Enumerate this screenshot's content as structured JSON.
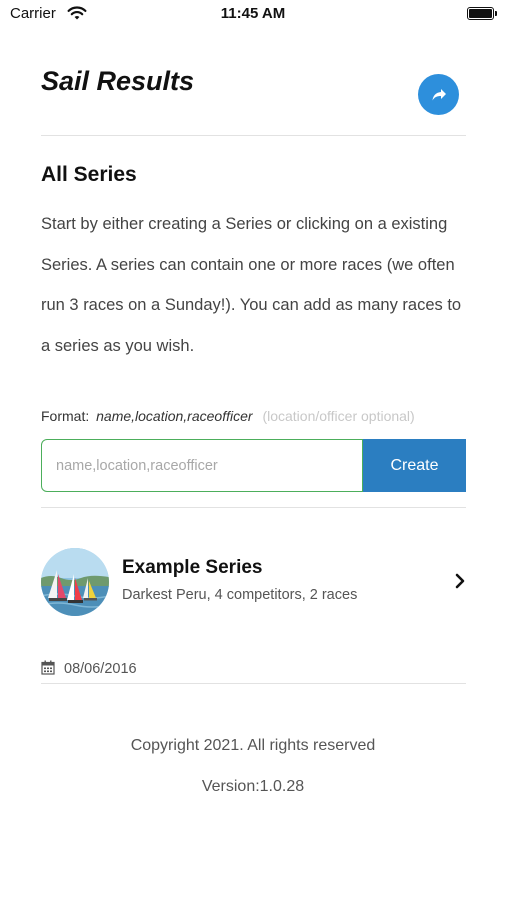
{
  "status_bar": {
    "carrier": "Carrier",
    "time": "11:45 AM",
    "battery_level": 1.0
  },
  "header": {
    "title": "Sail Results",
    "share_icon": "share-icon",
    "accent_color": "#2d8fdc"
  },
  "series_section": {
    "title": "All Series",
    "intro_text": "Start by either creating a Series or clicking on a existing Series. A series can contain one or more races (we often run 3 races on a Sunday!). You can add as many races to a series as you wish."
  },
  "create_form": {
    "format_label": "Format:",
    "format_example": "name,location,raceofficer",
    "format_optional": "(location/officer optional)",
    "input_value": "",
    "input_placeholder": "name,location,raceofficer",
    "create_label": "Create",
    "input_border_color": "#4cae5b",
    "button_color": "#2b7ec1"
  },
  "series_list": [
    {
      "name": "Example Series",
      "detail": "Darkest Peru, 4 competitors, 2 races",
      "date": "08/06/2016",
      "icon": "chevron-right-icon"
    }
  ],
  "footer": {
    "copyright": "Copyright 2021. All rights reserved",
    "version": "Version:1.0.28"
  }
}
